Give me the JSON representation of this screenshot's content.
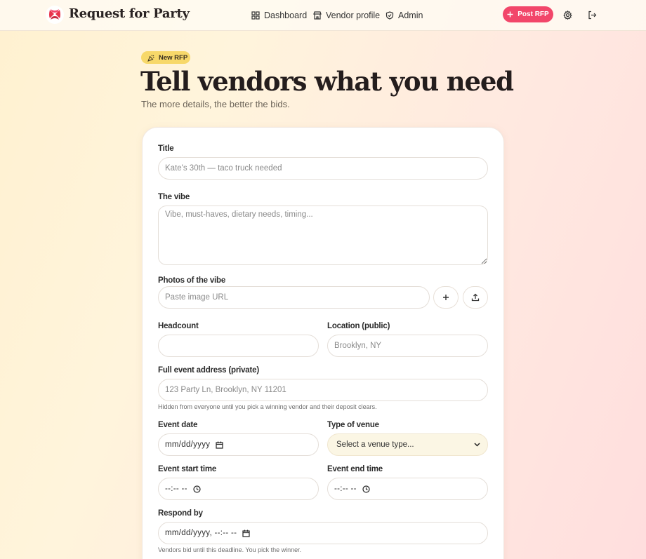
{
  "header": {
    "brand": "Request for Party",
    "nav": [
      {
        "label": "Dashboard",
        "icon": "grid-icon"
      },
      {
        "label": "Vendor profile",
        "icon": "store-icon"
      },
      {
        "label": "Admin",
        "icon": "shield-icon"
      }
    ],
    "post_button": "Post RFP",
    "settings_icon": "gear-icon",
    "logout_icon": "logout-icon"
  },
  "hero": {
    "badge": "New RFP",
    "title": "Tell vendors what you need",
    "subtitle": "The more details, the better the bids."
  },
  "form": {
    "title": {
      "label": "Title",
      "placeholder": "Kate's 30th — taco truck needed"
    },
    "vibe": {
      "label": "The vibe",
      "placeholder": "Vibe, must-haves, dietary needs, timing..."
    },
    "photos": {
      "label": "Photos of the vibe",
      "placeholder": "Paste image URL"
    },
    "headcount": {
      "label": "Headcount",
      "value": ""
    },
    "location": {
      "label": "Location (public)",
      "placeholder": "Brooklyn, NY"
    },
    "address": {
      "label": "Full event address (private)",
      "placeholder": "123 Party Ln, Brooklyn, NY 11201",
      "hint": "Hidden from everyone until you pick a winning vendor and their deposit clears."
    },
    "event_date": {
      "label": "Event date",
      "placeholder": "mm/dd/yyyy"
    },
    "venue_type": {
      "label": "Type of venue",
      "selected": "Select a venue type..."
    },
    "start_time": {
      "label": "Event start time",
      "placeholder": "--:-- --"
    },
    "end_time": {
      "label": "Event end time",
      "placeholder": "--:-- --"
    },
    "respond_by": {
      "label": "Respond by",
      "placeholder": "mm/dd/yyyy, --:-- --",
      "hint": "Vendors bid until this deadline. You pick the winner."
    }
  },
  "colors": {
    "accent": "#f2466a",
    "badge": "#f7d86a",
    "select_bg": "#fbf6e4"
  }
}
